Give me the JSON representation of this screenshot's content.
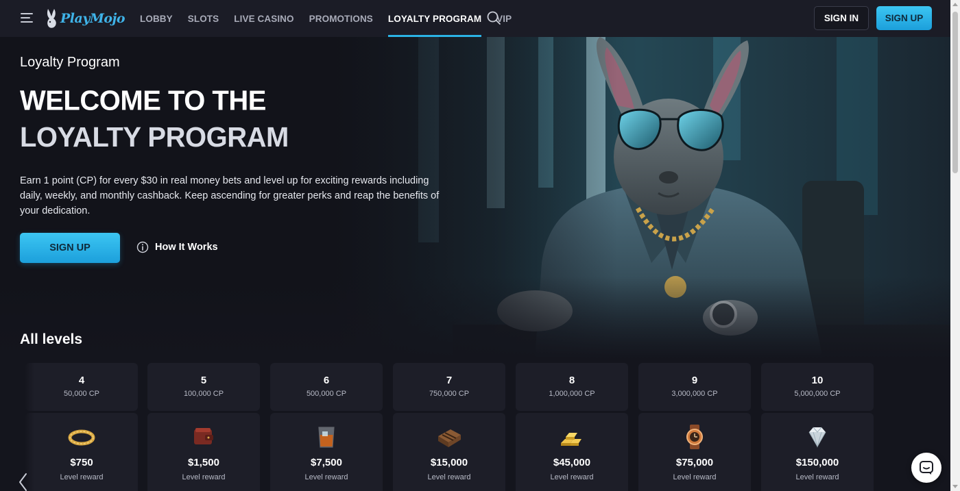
{
  "header": {
    "logo_text": "PlayMojo",
    "nav": [
      {
        "label": "LOBBY"
      },
      {
        "label": "SLOTS"
      },
      {
        "label": "LIVE CASINO"
      },
      {
        "label": "PROMOTIONS"
      },
      {
        "label": "LOYALTY PROGRAM",
        "active": true
      },
      {
        "label": "VIP"
      }
    ],
    "sign_in": "SIGN IN",
    "sign_up": "SIGN UP"
  },
  "hero": {
    "subtitle": "Loyalty Program",
    "title_line1": "WELCOME TO THE",
    "title_line2": "LOYALTY PROGRAM",
    "description": "Earn 1 point (CP) for every $30 in real money bets and level up for exciting rewards including daily, weekly, and monthly cashback. Keep ascending for greater perks and reap the benefits of your dedication.",
    "signup_label": "SIGN UP",
    "how_it_works": "How It Works"
  },
  "levels": {
    "title": "All levels",
    "items": [
      {
        "level": "4",
        "cp": "50,000 CP",
        "reward": "$750",
        "reward_label": "Level reward",
        "icon": "bracelet-icon"
      },
      {
        "level": "5",
        "cp": "100,000 CP",
        "reward": "$1,500",
        "reward_label": "Level reward",
        "icon": "wallet-icon"
      },
      {
        "level": "6",
        "cp": "500,000 CP",
        "reward": "$7,500",
        "reward_label": "Level reward",
        "icon": "whiskey-glass-icon"
      },
      {
        "level": "7",
        "cp": "750,000 CP",
        "reward": "$15,000",
        "reward_label": "Level reward",
        "icon": "cigar-box-icon"
      },
      {
        "level": "8",
        "cp": "1,000,000 CP",
        "reward": "$45,000",
        "reward_label": "Level reward",
        "icon": "gold-bars-icon"
      },
      {
        "level": "9",
        "cp": "3,000,000 CP",
        "reward": "$75,000",
        "reward_label": "Level reward",
        "icon": "watch-icon"
      },
      {
        "level": "10",
        "cp": "5,000,000 CP",
        "reward": "$150,000",
        "reward_label": "Level reward",
        "icon": "diamond-icon"
      }
    ]
  },
  "colors": {
    "accent": "#2bb3e5",
    "background": "#14151d",
    "header": "#1b1c26",
    "card": "#1d1e28"
  }
}
